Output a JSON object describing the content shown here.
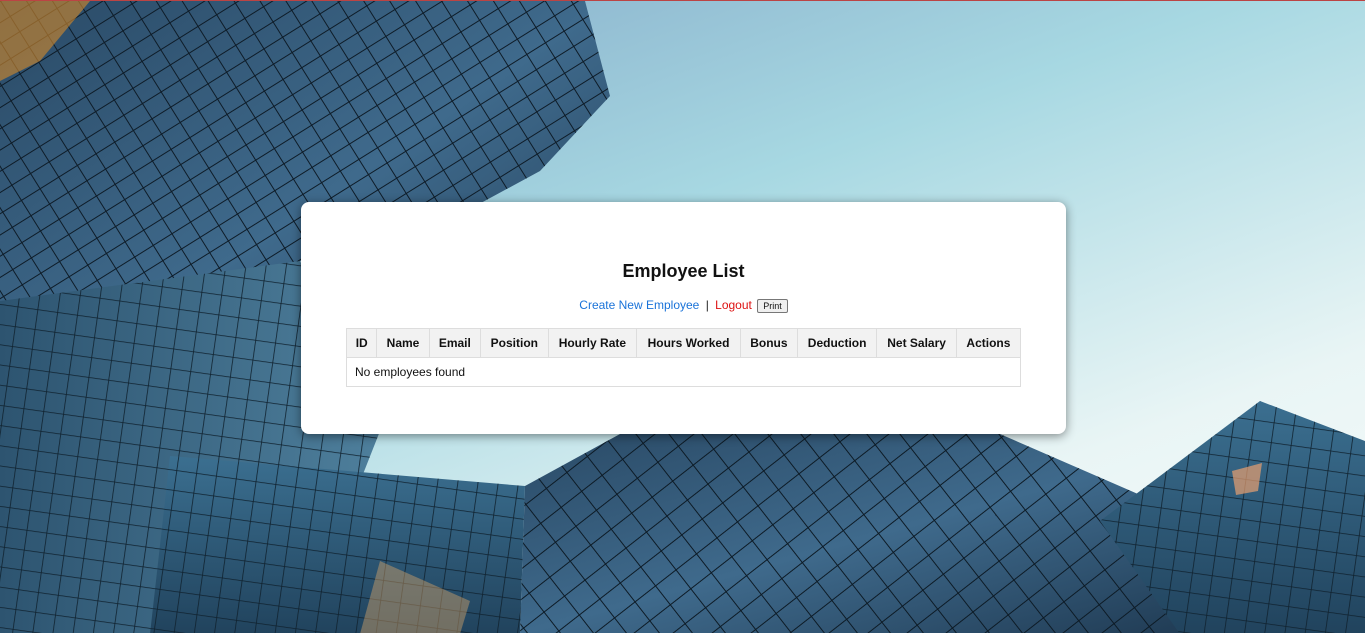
{
  "page": {
    "title": "Employee List"
  },
  "actions": {
    "create_label": "Create New Employee",
    "separator": "|",
    "logout_label": "Logout",
    "print_label": "Print"
  },
  "table": {
    "columns": [
      "ID",
      "Name",
      "Email",
      "Position",
      "Hourly Rate",
      "Hours Worked",
      "Bonus",
      "Deduction",
      "Net Salary",
      "Actions"
    ],
    "empty_message": "No employees found"
  },
  "colors": {
    "create_link": "#1a73d9",
    "logout_link": "#dd1111",
    "header_bg": "#f2f2f2"
  }
}
